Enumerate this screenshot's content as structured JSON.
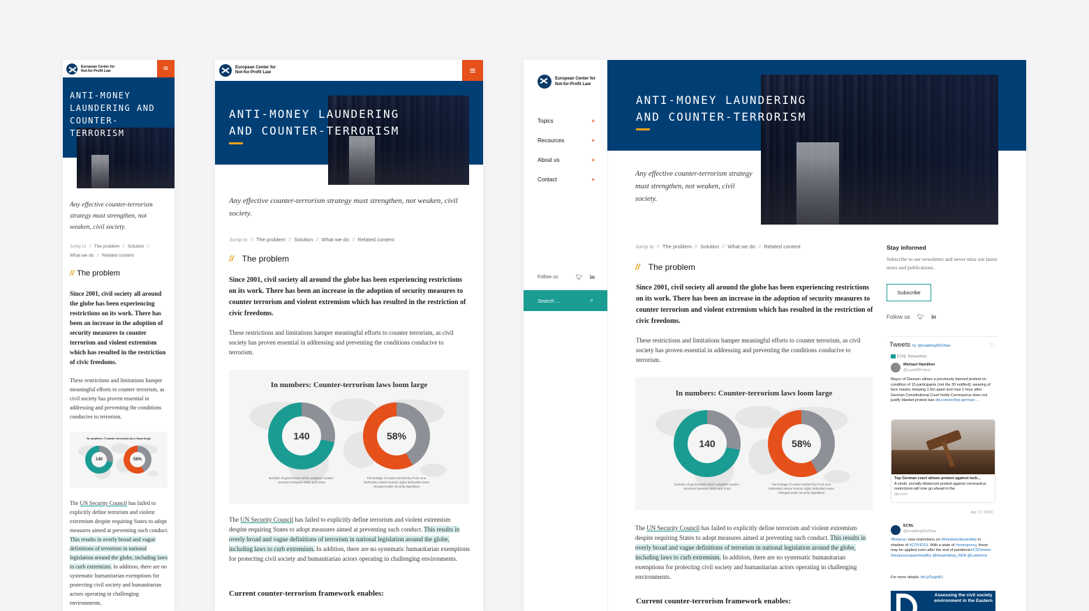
{
  "brand": {
    "line1": "European Center for",
    "line2": "Not-for-Profit Law"
  },
  "hero": {
    "title": "Anti-money laundering and counter-terrorism"
  },
  "lead": "Any effective counter-terrorism strategy must strengthen, not weaken, civil society.",
  "breadcrumb": {
    "jump": "Jump to",
    "items": [
      "The problem",
      "Solution",
      "What we do",
      "Related content"
    ]
  },
  "section": {
    "slash": "//",
    "heading": "The problem"
  },
  "body": {
    "intro": "Since 2001, civil society all around the globe has been experiencing restrictions on its work. There has been an increase in the adoption of security measures to counter terrorism and violent extremism which has resulted in the restriction of civic freedoms.",
    "para2": "These restrictions and limitations hamper meaningful efforts to counter terrorism, as civil society has proven essential in addressing and preventing the conditions conducive to terrorism.",
    "p3_start": "The ",
    "p3_link": "UN Security Council",
    "p3_mid": " has failed to explicitly define terrorism and violent extremism despite requiring States to adopt measures aimed at preventing such conduct. ",
    "p3_hl": "This results in overly broad and vague definitions of terrorism in national legislation around the globe, including laws to curb extremism.",
    "p3_end": " In addition, there are no systematic humanitarian exemptions for protecting civil society and humanitarian actors operating in challenging environments.",
    "framework": "Current counter-terrorism framework enables:"
  },
  "infographic": {
    "title": "In numbers: Counter-terrorism laws loom large",
    "stat1": "140",
    "stat1_caption": "Number of goverments which adopted counter-terrorism between 2001 and 2018",
    "stat1_fraction": 0.72,
    "stat2": "58%",
    "stat2_caption": "Percentage of cases tracked by Front Line Defenders where human rights defenders were charged under security legislation",
    "stat2_fraction": 0.58,
    "colors": {
      "teal": "#1a9c93",
      "orange": "#e5501b",
      "grey": "#8e9097"
    }
  },
  "sidebar": {
    "menu": [
      {
        "label": "Topics",
        "icon": "plus-icon"
      },
      {
        "label": "Recources",
        "icon": "plus-icon"
      },
      {
        "label": "About us",
        "icon": "plus-icon"
      },
      {
        "label": "Contact",
        "icon": "plus-icon"
      }
    ],
    "follow": "Follow us",
    "search_placeholder": "Search ..."
  },
  "aside": {
    "stay_title": "Stay informed",
    "stay_text": "Subscribe to our newsletter and never miss our latest news and publications.",
    "subscribe": "Subscribe",
    "follow": "Follow us"
  },
  "tweets": {
    "header": "Tweets",
    "by": "by @enablingNGOlaw",
    "retweeted": "ECNL Retweeted",
    "t1_name": "Michael Hamilton",
    "t1_handle": "@LawOfProtest",
    "t1_text": "Mayor of Giessen allows a previously banned protest on condition of 15 participants (not the 30 notified); wearing of face masks; keeping 1.5m apart and max 1-hour after German Constitutional Court holds Coronavirus does not justify blanket protest ban",
    "t1_link": "dw.com/en/top-german-...",
    "card_title": "Top German court allows protest against lock...",
    "card_text": "A small, socially-distanced protest against coronavirus restrictions will now go ahead in the",
    "card_domain": "dw.com",
    "t1_date": "Apr 17, 2020",
    "t2_name": "ECNL",
    "t2_handle": "@enablingNGOlaw",
    "t2_text_a": "#Belarus",
    "t2_text_b": ": new restrictions on ",
    "t2_text_c": "#freedomofassembly",
    "t2_text_d": " in shadow of ",
    "t2_text_e": "#COVID19",
    "t2_text_f": ". With a state of ",
    "t2_text_g": "#emergency",
    "t2_text_h": ", these may be applied even after the end of pandemic",
    "t2_text_i": "#CSOmeter #keepcivicspacehealthy @Assambleja_NDA @Lawtrend",
    "t2_more": "For more details: ",
    "t2_link": "bit.ly/2yighKL",
    "banner": "Assessing the civil society environment in the Eastern"
  },
  "menu_icon": "hamburger-icon",
  "social_icons": [
    "twitter-icon",
    "linkedin-icon"
  ]
}
